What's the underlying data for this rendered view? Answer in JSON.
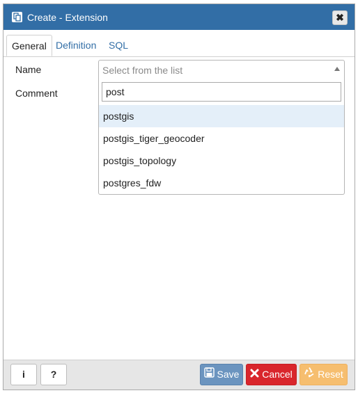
{
  "dialog": {
    "title": "Create - Extension",
    "close_label": "✖"
  },
  "tabs": [
    {
      "label": "General",
      "active": true
    },
    {
      "label": "Definition",
      "active": false
    },
    {
      "label": "SQL",
      "active": false
    }
  ],
  "form": {
    "name_label": "Name",
    "comment_label": "Comment",
    "name_placeholder": "Select from the list"
  },
  "dropdown": {
    "search_value": "post",
    "options": [
      {
        "label": "postgis",
        "highlighted": true
      },
      {
        "label": "postgis_tiger_geocoder",
        "highlighted": false
      },
      {
        "label": "postgis_topology",
        "highlighted": false
      },
      {
        "label": "postgres_fdw",
        "highlighted": false
      }
    ]
  },
  "footer": {
    "info_label": "i",
    "help_label": "?",
    "save_label": "Save",
    "cancel_label": "Cancel",
    "reset_label": "Reset"
  },
  "colors": {
    "titlebar": "#326ea6",
    "save": "#6b94bf",
    "cancel": "#d9262c",
    "reset": "#f6be6f"
  }
}
